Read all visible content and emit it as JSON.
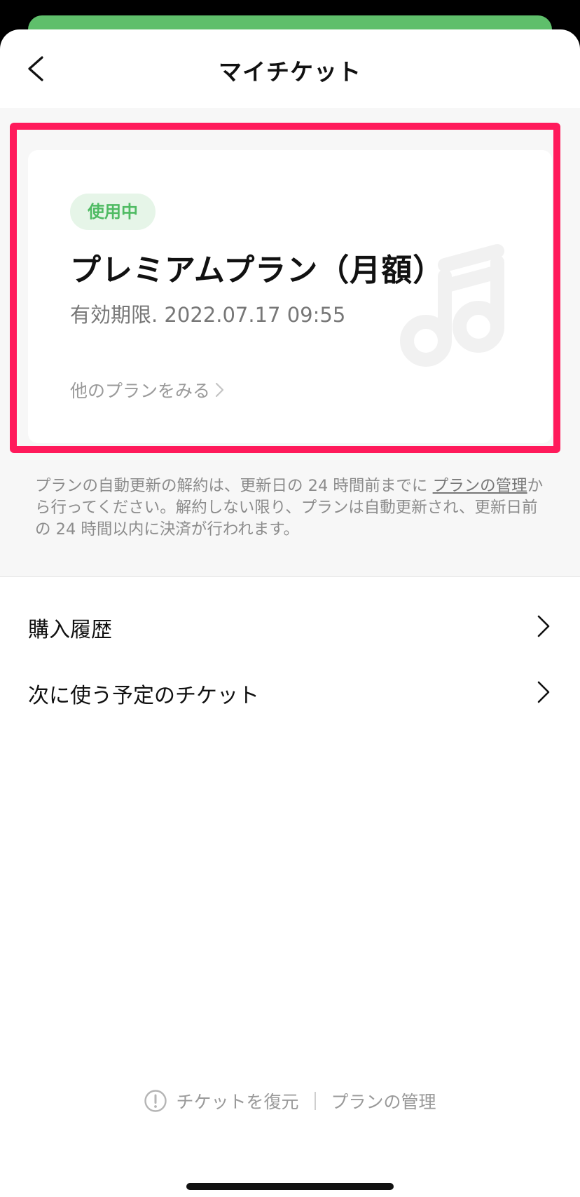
{
  "header": {
    "title": "マイチケット"
  },
  "plan_card": {
    "status_badge": "使用中",
    "plan_name": "プレミアムプラン（月額）",
    "expiry": "有効期限. 2022.07.17 09:55",
    "other_plans_link": "他のプランをみる"
  },
  "notice": {
    "text_before_link": "プランの自動更新の解約は、更新日の 24 時間前までに ",
    "link": "プランの管理",
    "text_after_link": "から行ってください。解約しない限り、プランは自動更新され、更新日前の 24 時間以内に決済が行われます。"
  },
  "menu": {
    "items": [
      {
        "label": "購入履歴"
      },
      {
        "label": "次に使う予定のチケット"
      }
    ]
  },
  "footer": {
    "restore_label": "チケットを復元",
    "manage_label": "プランの管理"
  },
  "colors": {
    "accent_green": "#4fbb63",
    "highlight_pink": "#ff1a5b"
  }
}
